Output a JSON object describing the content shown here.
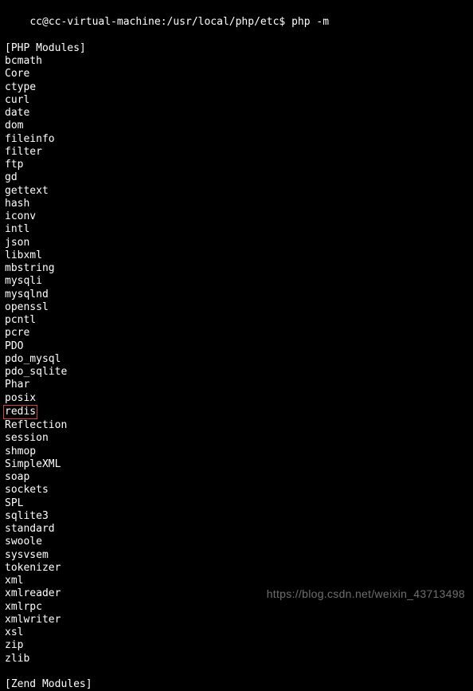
{
  "prompt": {
    "user_host": "cc@cc-virtual-machine",
    "separator": ":",
    "path": "/usr/local/php/etc",
    "symbol": "$",
    "command": "php -m"
  },
  "sections": {
    "php_modules_header": "[PHP Modules]",
    "zend_modules_header": "[Zend Modules]"
  },
  "modules": [
    "bcmath",
    "Core",
    "ctype",
    "curl",
    "date",
    "dom",
    "fileinfo",
    "filter",
    "ftp",
    "gd",
    "gettext",
    "hash",
    "iconv",
    "intl",
    "json",
    "libxml",
    "mbstring",
    "mysqli",
    "mysqlnd",
    "openssl",
    "pcntl",
    "pcre",
    "PDO",
    "pdo_mysql",
    "pdo_sqlite",
    "Phar",
    "posix",
    "redis",
    "Reflection",
    "session",
    "shmop",
    "SimpleXML",
    "soap",
    "sockets",
    "SPL",
    "sqlite3",
    "standard",
    "swoole",
    "sysvsem",
    "tokenizer",
    "xml",
    "xmlreader",
    "xmlrpc",
    "xmlwriter",
    "xsl",
    "zip",
    "zlib"
  ],
  "highlighted_module": "redis",
  "watermark": "https://blog.csdn.net/weixin_43713498"
}
